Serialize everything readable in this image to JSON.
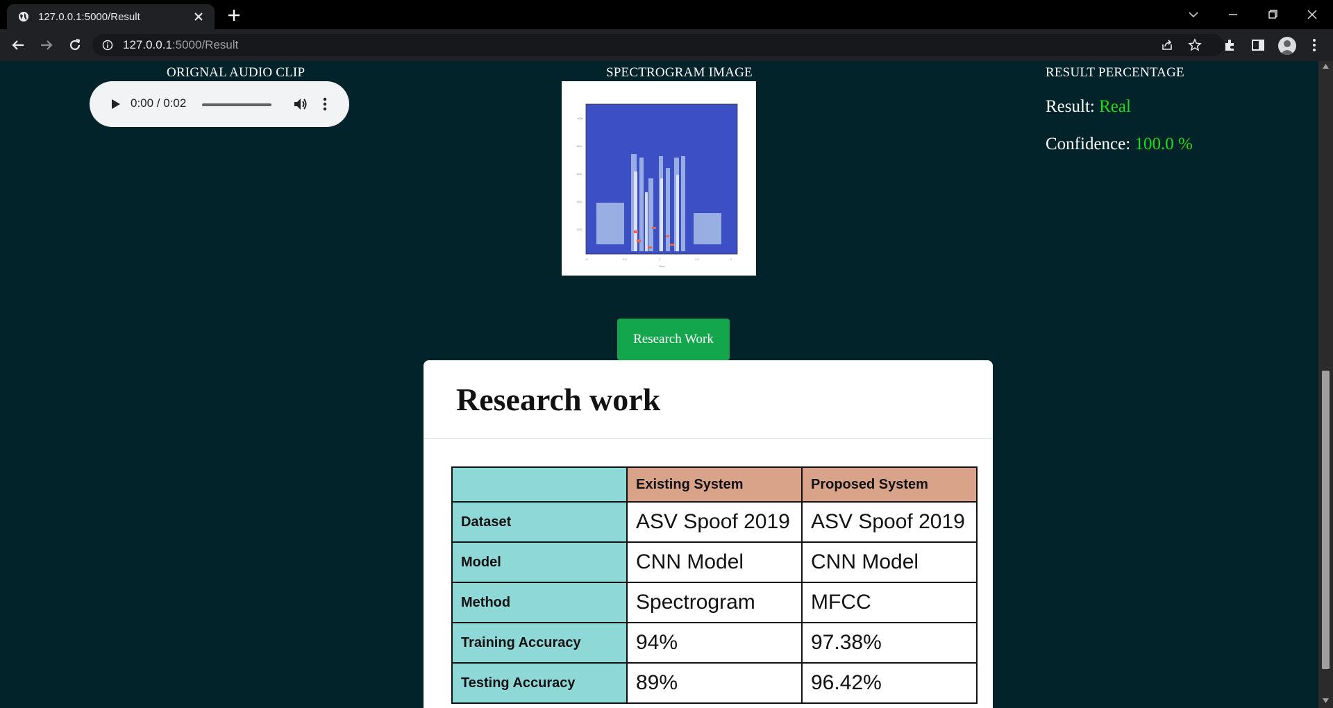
{
  "browser": {
    "tab_title": "127.0.0.1:5000/Result",
    "url_host": "127.0.0.1",
    "url_rest": ":5000/Result"
  },
  "page": {
    "audio_heading": "ORIGNAL AUDIO CLIP",
    "audio_time": "0:00 / 0:02",
    "spectrogram_heading": "SPECTROGRAM IMAGE",
    "result_heading": "RESULT PERCENTAGE",
    "result_label": "Result:",
    "result_value": "Real",
    "confidence_label": "Confidence:",
    "confidence_value": "100.0 %",
    "research_button": "Research Work",
    "card_title": "Research work",
    "table": {
      "headers": [
        "",
        "Existing System",
        "Proposed System"
      ],
      "rows": [
        [
          "Dataset",
          "ASV Spoof 2019",
          "ASV Spoof 2019"
        ],
        [
          "Model",
          "CNN Model",
          "CNN Model"
        ],
        [
          "Method",
          "Spectrogram",
          "MFCC"
        ],
        [
          "Training Accuracy",
          "94%",
          "97.38%"
        ],
        [
          "Testing Accuracy",
          "89%",
          "96.42%"
        ]
      ]
    }
  },
  "colors": {
    "page_bg": "#03232a",
    "accent_green": "#1edb1e",
    "button_green": "#14a64c",
    "table_teal": "#8fd8d8",
    "table_salmon": "#d9a38a"
  }
}
